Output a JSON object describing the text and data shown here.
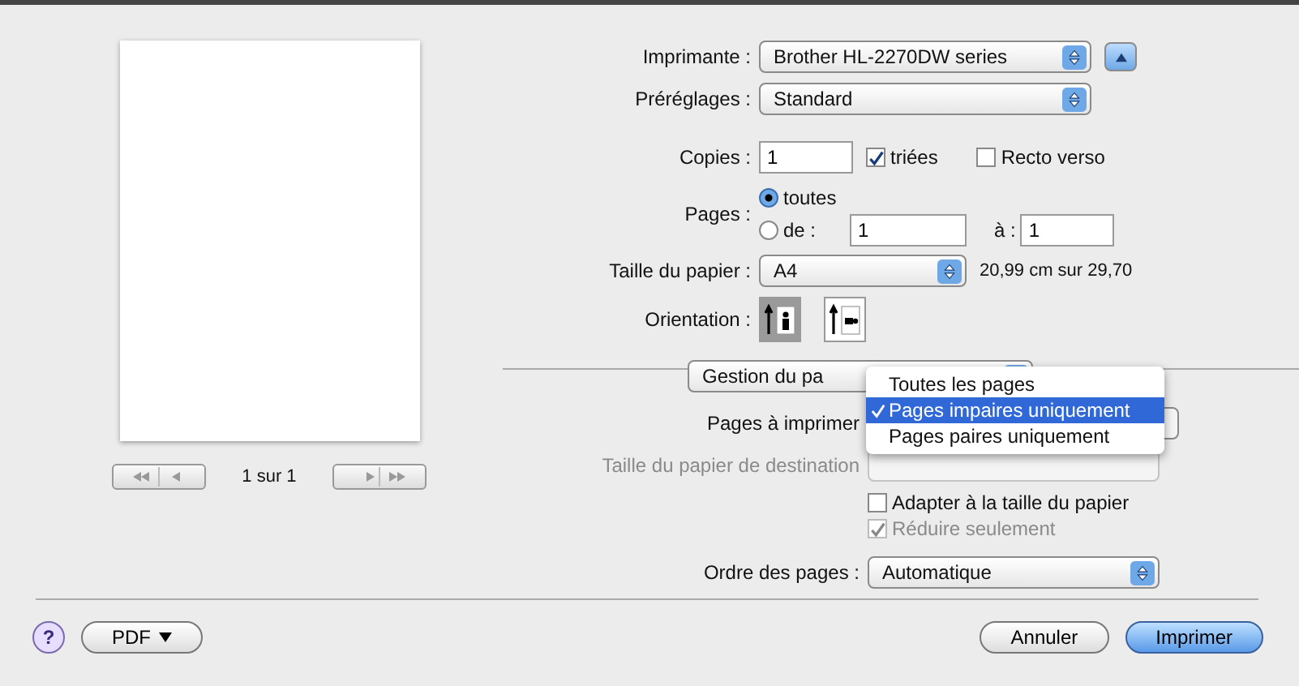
{
  "page_counter": "1 sur 1",
  "printer": {
    "label": "Imprimante :",
    "value": "Brother HL-2270DW series",
    "expanded": true
  },
  "presets": {
    "label": "Préréglages :",
    "value": "Standard"
  },
  "copies": {
    "label": "Copies :",
    "value": "1"
  },
  "collated": {
    "label": "triées",
    "checked": true
  },
  "two_sided": {
    "label": "Recto verso",
    "checked": false
  },
  "pages": {
    "label": "Pages :",
    "from": "1",
    "to_label": "à :",
    "to": "1",
    "options": [
      {
        "label": "toutes",
        "selected": true
      },
      {
        "label": "de :",
        "selected": false
      }
    ]
  },
  "paper_size": {
    "label": "Taille du papier :",
    "value": "A4",
    "dimensions": "20,99 cm sur 29,70"
  },
  "orientation": {
    "label": "Orientation :",
    "options": [
      {
        "kind": "portrait",
        "selected": true
      },
      {
        "kind": "landscape",
        "selected": false
      }
    ]
  },
  "section_popup": {
    "value": "Gestion du pa"
  },
  "pages_to_print": {
    "label": "Pages à imprimer",
    "menu": [
      {
        "label": "Toutes les pages",
        "selected": false
      },
      {
        "label": "Pages impaires uniquement",
        "selected": true
      },
      {
        "label": "Pages paires uniquement",
        "selected": false
      }
    ]
  },
  "destination_size": {
    "label": "Taille du papier de destination",
    "disabled": true
  },
  "fit_to_paper": {
    "label": "Adapter à la taille du papier",
    "checked": false,
    "disabled": false
  },
  "scale_down_only": {
    "label": "Réduire seulement",
    "checked": true,
    "disabled": true
  },
  "page_order": {
    "label": "Ordre des pages :",
    "value": "Automatique"
  },
  "help": "?",
  "pdf_button": "PDF",
  "buttons": [
    {
      "label": "Annuler",
      "kind": "cancel"
    },
    {
      "label": "Imprimer",
      "kind": "default"
    }
  ]
}
